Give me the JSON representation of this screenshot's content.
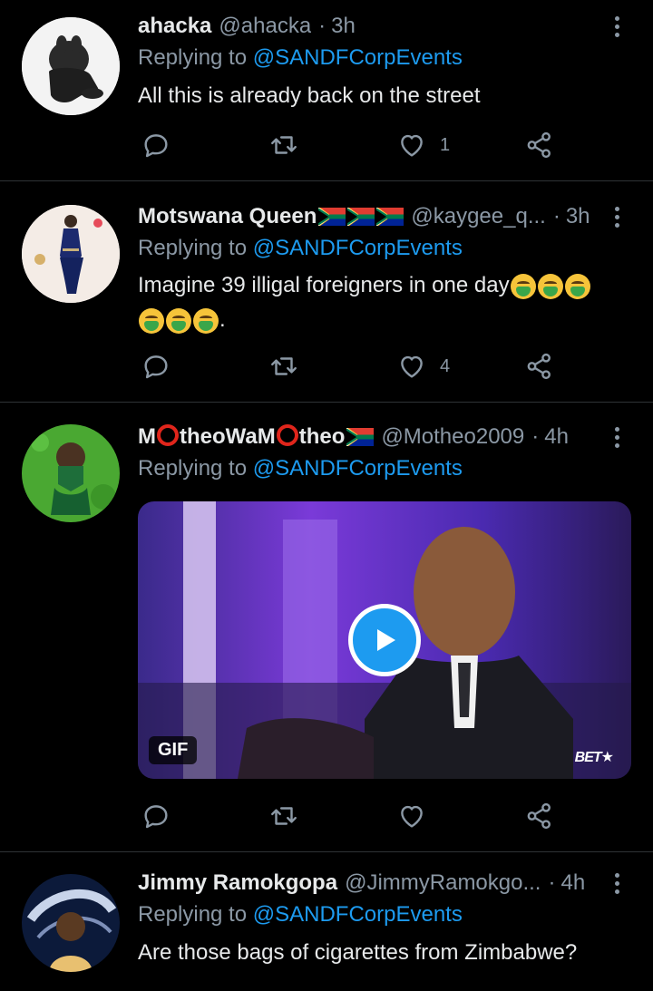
{
  "colors": {
    "background": "#000000",
    "link": "#1d9bf0",
    "muted": "#8b98a5",
    "text": "#e7e9ea"
  },
  "tweets": [
    {
      "name": "ahacka",
      "handle": "@ahacka",
      "time": "3h",
      "reply_prefix": "Replying to",
      "reply_to": "@SANDFCorpEvents",
      "text": "All this is already back on the street",
      "likes": "1"
    },
    {
      "name": "Motswana Queen",
      "handle": "@kaygee_q...",
      "time": "3h",
      "reply_prefix": "Replying to",
      "reply_to": "@SANDFCorpEvents",
      "text": "Imagine 39 illigal foreigners in one day",
      "text_end": ".",
      "likes": "4"
    },
    {
      "name_a": "M",
      "name_b": "theoWaM",
      "name_c": "theo",
      "handle": "@Motheo2009",
      "time": "4h",
      "reply_prefix": "Replying to",
      "reply_to": "@SANDFCorpEvents",
      "gif_label": "GIF",
      "watermark": "BET★",
      "likes": ""
    },
    {
      "name": "Jimmy Ramokgopa",
      "handle": "@JimmyRamokgo...",
      "time": "4h",
      "reply_prefix": "Replying to",
      "reply_to": "@SANDFCorpEvents",
      "text": "Are those bags of cigarettes from Zimbabwe?"
    }
  ],
  "separator": "·",
  "icons": [
    "reply-icon",
    "retweet-icon",
    "like-icon",
    "share-icon",
    "more-icon",
    "play-icon"
  ]
}
